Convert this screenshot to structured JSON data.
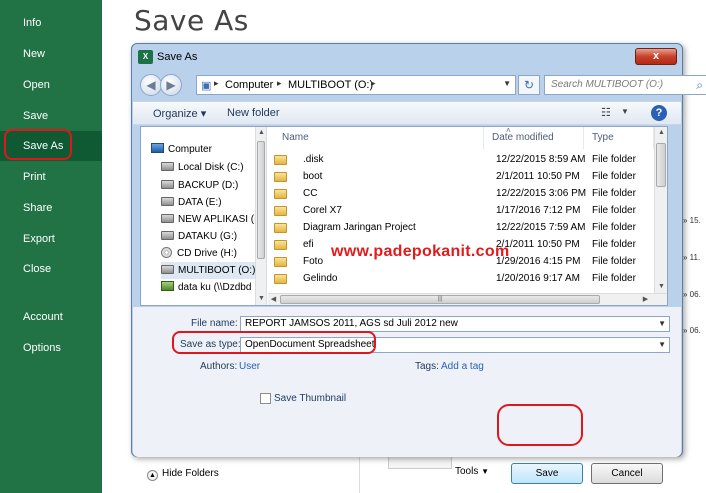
{
  "backstage": {
    "title": "Save As",
    "nav": [
      "Info",
      "New",
      "Open",
      "Save",
      "Save As",
      "Print",
      "Share",
      "Export",
      "Close",
      "Account",
      "Options"
    ],
    "bg_dates": [
      "» 15.",
      "» 11.",
      "» 06.",
      "» 06."
    ]
  },
  "dialog": {
    "title": "Save As",
    "close_label": "x",
    "address": {
      "crumbs": [
        "Computer",
        "MULTIBOOT (O:)"
      ]
    },
    "search_placeholder": "Search MULTIBOOT (O:)",
    "toolbar": {
      "organize": "Organize ▾",
      "new_folder": "New folder"
    },
    "nav_pane": [
      {
        "label": "Computer",
        "icon": "computer-icon"
      },
      {
        "label": "Local Disk (C:)",
        "icon": "drive-icon"
      },
      {
        "label": "BACKUP (D:)",
        "icon": "drive-icon"
      },
      {
        "label": "DATA (E:)",
        "icon": "drive-icon"
      },
      {
        "label": "NEW APLIKASI (F",
        "icon": "drive-icon"
      },
      {
        "label": "DATAKU (G:)",
        "icon": "drive-icon"
      },
      {
        "label": "CD Drive (H:)",
        "icon": "cd-icon"
      },
      {
        "label": "MULTIBOOT (O:)",
        "icon": "drive-icon",
        "selected": true
      },
      {
        "label": "data ku (\\\\Dzdbd",
        "icon": "net-icon"
      }
    ],
    "columns": [
      "Name",
      "Date modified",
      "Type"
    ],
    "files": [
      {
        "name": ".disk",
        "date": "12/22/2015 8:59 AM",
        "type": "File folder"
      },
      {
        "name": "boot",
        "date": "2/1/2011 10:50 PM",
        "type": "File folder"
      },
      {
        "name": "CC",
        "date": "12/22/2015 3:06 PM",
        "type": "File folder"
      },
      {
        "name": "Corel X7",
        "date": "1/17/2016 7:12 PM",
        "type": "File folder"
      },
      {
        "name": "Diagram Jaringan Project",
        "date": "12/22/2015 7:59 AM",
        "type": "File folder"
      },
      {
        "name": "efi",
        "date": "2/1/2011 10:50 PM",
        "type": "File folder"
      },
      {
        "name": "Foto",
        "date": "1/29/2016 4:15 PM",
        "type": "File folder"
      },
      {
        "name": "Gelindo",
        "date": "1/20/2016 9:17 AM",
        "type": "File folder"
      }
    ],
    "watermark": "www.padepokanit.com",
    "form": {
      "file_name_label": "File name:",
      "file_name_value": "REPORT JAMSOS 2011, AGS sd Juli 2012 new",
      "save_type_label": "Save as type:",
      "save_type_value": "OpenDocument Spreadsheet",
      "authors_label": "Authors:",
      "authors_value": "User",
      "tags_label": "Tags:",
      "tags_value": "Add a tag",
      "thumbnail_label": "Save Thumbnail",
      "hide_folders": "Hide Folders",
      "tools": "Tools",
      "save": "Save",
      "cancel": "Cancel"
    }
  },
  "colors": {
    "excel_green": "#217346",
    "highlight_red": "#e0161f",
    "dialog_frame": "#b9d1ea"
  }
}
